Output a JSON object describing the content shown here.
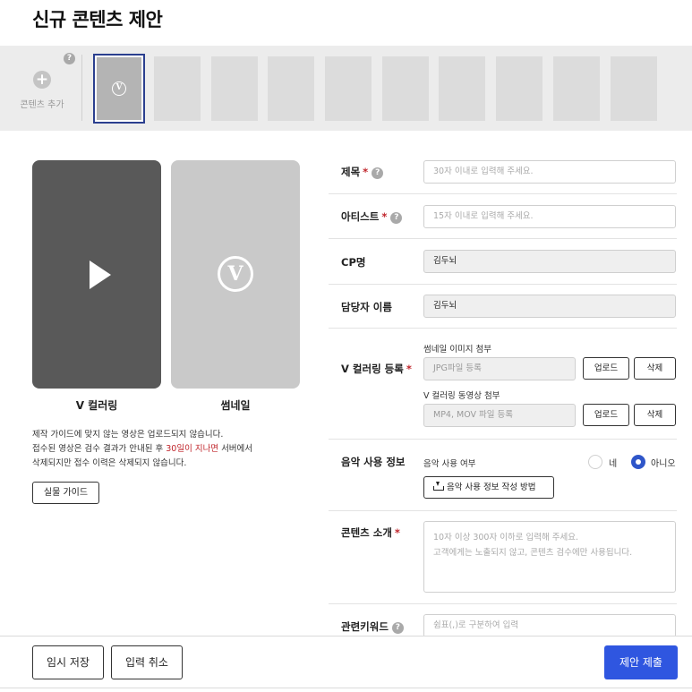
{
  "page": {
    "title": "신규 콘텐츠 제안"
  },
  "strip": {
    "add_label": "콘텐츠 추가",
    "help": "?",
    "thumb_glyph": "V"
  },
  "preview": {
    "video_label": "V 컬러링",
    "thumb_label": "썸네일",
    "play_icon": "play-icon",
    "v_glyph": "V"
  },
  "notice": {
    "line1": "제작 가이드에 맞지 않는 영상은 업로드되지 않습니다.",
    "line2_a": "접수된 영상은 검수 결과가 안내된 후 ",
    "line2_red": "30일이 지나면",
    "line2_b": " 서버에서",
    "line3": "삭제되지만 접수 이력은 삭제되지 않습니다.",
    "accent_color": "#c0262c"
  },
  "guide_button": "실물 가이드",
  "form": {
    "title": {
      "label": "제목",
      "required": "*",
      "help": "?",
      "placeholder": "30자 이내로 입력해 주세요."
    },
    "artist": {
      "label": "아티스트",
      "required": "*",
      "help": "?",
      "placeholder": "15자 이내로 입력해 주세요."
    },
    "cp": {
      "label": "CP명",
      "value": "김두뇌"
    },
    "manager": {
      "label": "담당자 이름",
      "value": "김두뇌"
    },
    "vcoloring": {
      "label": "V 컬러링 등록",
      "required": "*",
      "thumb_sub": "썸네일 이미지 첨부",
      "thumb_placeholder": "JPG파일 등록",
      "video_sub": "V 컬러링 동영상 첨부",
      "video_placeholder": "MP4, MOV 파일 등록",
      "upload": "업로드",
      "delete": "삭제"
    },
    "music": {
      "label": "음악 사용 정보",
      "sub": "음악 사용 여부",
      "yes": "네",
      "no": "아니오",
      "selected": "아니오",
      "guide": "음악 사용 정보 작성 방법"
    },
    "intro": {
      "label": "콘텐츠 소개",
      "required": "*",
      "placeholder1": "10자 이상 300자 이하로 입력해 주세요.",
      "placeholder2": "고객에게는 노출되지 않고, 콘텐츠 검수에만 사용됩니다."
    },
    "keywords": {
      "label": "관련키워드",
      "help": "?",
      "placeholder": "쉼표(,)로 구분하여 입력"
    }
  },
  "actions": {
    "save": "임시 저장",
    "cancel": "입력 취소",
    "submit": "제안 제출",
    "submit_color": "#2f56e0"
  }
}
